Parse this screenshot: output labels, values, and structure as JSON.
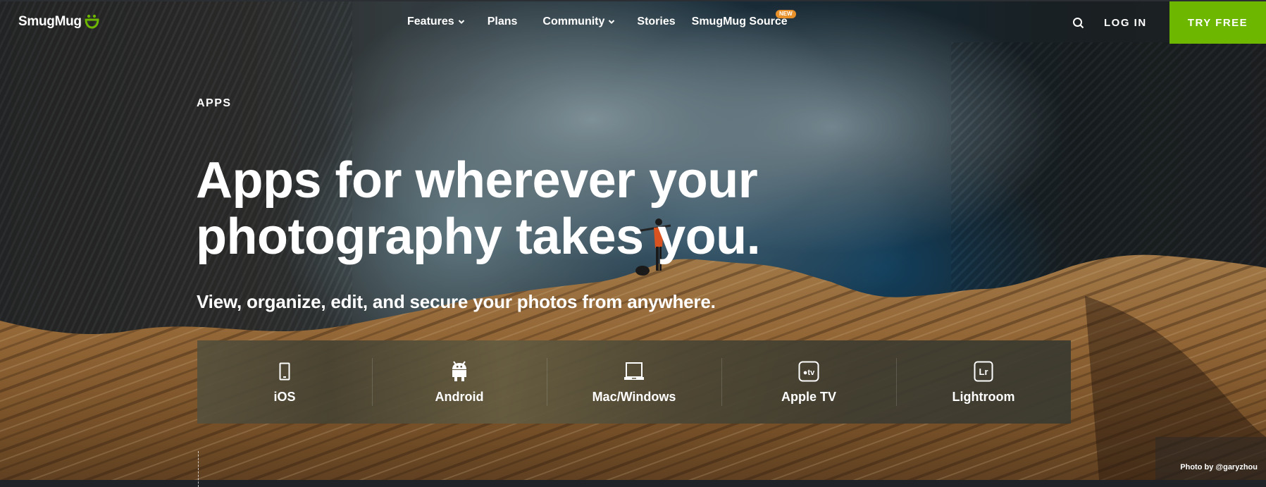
{
  "brand": {
    "name": "SmugMug",
    "logo_icon": "smiley-icon",
    "accent": "#6db700"
  },
  "nav": {
    "links": [
      {
        "label": "Features",
        "has_dropdown": true
      },
      {
        "label": "Plans",
        "has_dropdown": false
      },
      {
        "label": "Community",
        "has_dropdown": true
      },
      {
        "label": "Stories",
        "has_dropdown": false
      },
      {
        "label": "SmugMug Source",
        "has_dropdown": false,
        "badge": "NEW"
      }
    ],
    "search_icon": "search-icon",
    "login_label": "LOG IN",
    "cta_label": "TRY FREE"
  },
  "hero": {
    "eyebrow": "APPS",
    "headline_line1": "Apps for wherever your",
    "headline_line2": "photography takes you.",
    "subtitle": "View, organize, edit, and secure your photos from anywhere.",
    "photo_credit": "Photo by @garyzhou"
  },
  "apps": [
    {
      "label": "iOS",
      "icon": "smartphone-icon"
    },
    {
      "label": "Android",
      "icon": "android-icon"
    },
    {
      "label": "Mac/Windows",
      "icon": "laptop-icon"
    },
    {
      "label": "Apple TV",
      "icon": "apple-tv-icon"
    },
    {
      "label": "Lightroom",
      "icon": "lightroom-icon"
    }
  ],
  "colors": {
    "cta": "#6db700",
    "badge": "#e8912a",
    "footer": "#1f2227"
  }
}
